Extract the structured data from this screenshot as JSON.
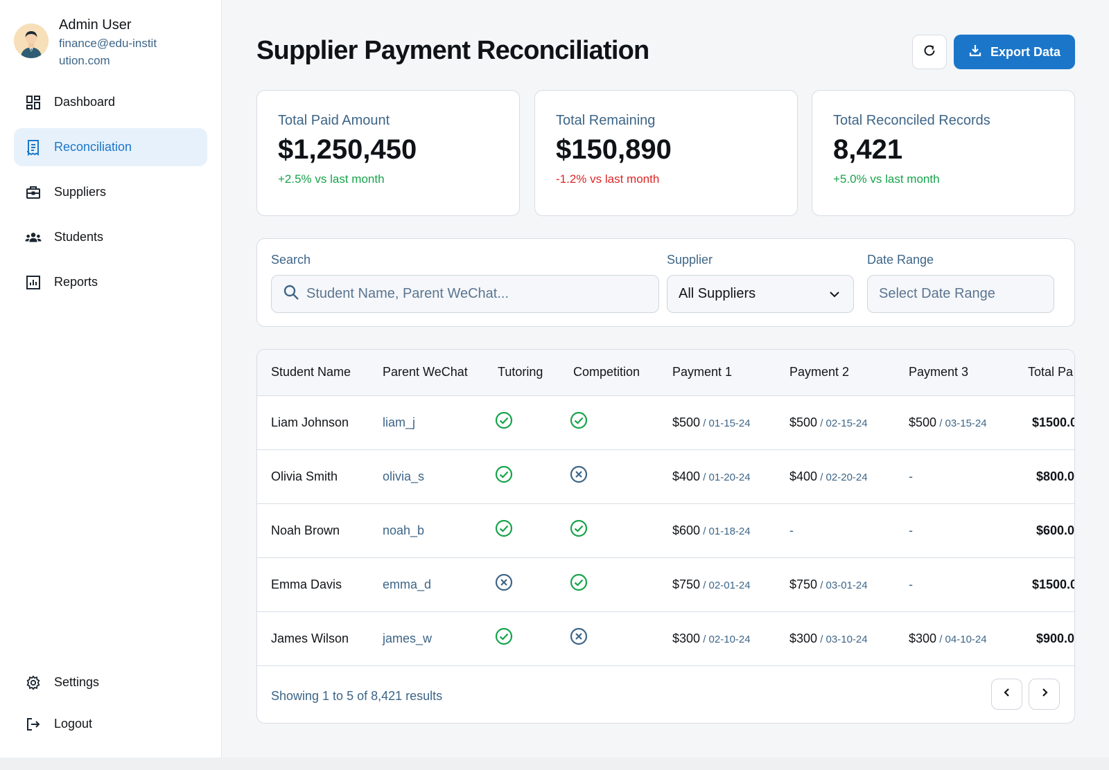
{
  "sidebar": {
    "user_name": "Admin User",
    "user_email": "finance@edu-institution.com",
    "nav": [
      {
        "label": "Dashboard",
        "icon": "dashboard-icon"
      },
      {
        "label": "Reconciliation",
        "icon": "receipt-icon",
        "active": true
      },
      {
        "label": "Suppliers",
        "icon": "briefcase-icon"
      },
      {
        "label": "Students",
        "icon": "group-icon"
      },
      {
        "label": "Reports",
        "icon": "bar-chart-icon"
      }
    ],
    "bottom_nav": [
      {
        "label": "Settings",
        "icon": "gear-icon"
      },
      {
        "label": "Logout",
        "icon": "logout-icon"
      }
    ]
  },
  "header": {
    "title": "Supplier Payment Reconciliation",
    "export_label": "Export Data"
  },
  "stats": [
    {
      "label": "Total Paid Amount",
      "value": "$1,250,450",
      "change": "+2.5% vs last month",
      "trend": "up"
    },
    {
      "label": "Total Remaining",
      "value": "$150,890",
      "change": "-1.2% vs last month",
      "trend": "down"
    },
    {
      "label": "Total Reconciled Records",
      "value": "8,421",
      "change": "+5.0% vs last month",
      "trend": "up"
    }
  ],
  "filters": {
    "search_label": "Search",
    "search_placeholder": "Student Name, Parent WeChat...",
    "supplier_label": "Supplier",
    "supplier_value": "All Suppliers",
    "date_label": "Date Range",
    "date_placeholder": "Select Date Range"
  },
  "table": {
    "columns": [
      "Student Name",
      "Parent WeChat",
      "Tutoring",
      "Competition",
      "Payment 1",
      "Payment 2",
      "Payment 3",
      "Total Pa"
    ],
    "rows": [
      {
        "name": "Liam Johnson",
        "wechat": "liam_j",
        "tutoring": true,
        "competition": true,
        "p1": {
          "amount": "$500",
          "date": " / 01-15-24"
        },
        "p2": {
          "amount": "$500",
          "date": " / 02-15-24"
        },
        "p3": {
          "amount": "$500",
          "date": " / 03-15-24"
        },
        "total": "$1500.0"
      },
      {
        "name": "Olivia Smith",
        "wechat": "olivia_s",
        "tutoring": true,
        "competition": false,
        "p1": {
          "amount": "$400",
          "date": " / 01-20-24"
        },
        "p2": {
          "amount": "$400",
          "date": " / 02-20-24"
        },
        "p3": "-",
        "total": "$800.0"
      },
      {
        "name": "Noah Brown",
        "wechat": "noah_b",
        "tutoring": true,
        "competition": true,
        "p1": {
          "amount": "$600",
          "date": " / 01-18-24"
        },
        "p2": "-",
        "p3": "-",
        "total": "$600.0"
      },
      {
        "name": "Emma Davis",
        "wechat": "emma_d",
        "tutoring": false,
        "competition": true,
        "p1": {
          "amount": "$750",
          "date": " / 02-01-24"
        },
        "p2": {
          "amount": "$750",
          "date": " / 03-01-24"
        },
        "p3": "-",
        "total": "$1500.0"
      },
      {
        "name": "James Wilson",
        "wechat": "james_w",
        "tutoring": true,
        "competition": false,
        "p1": {
          "amount": "$300",
          "date": " / 02-10-24"
        },
        "p2": {
          "amount": "$300",
          "date": " / 03-10-24"
        },
        "p3": {
          "amount": "$300",
          "date": " / 04-10-24"
        },
        "total": "$900.0"
      }
    ],
    "footer_text": "Showing 1 to 5 of 8,421 results"
  },
  "colors": {
    "accent": "#1b76c9",
    "positive": "#16a34a",
    "negative": "#dc2626",
    "muted_text": "#3d6587",
    "cross_icon": "#3d6587"
  }
}
